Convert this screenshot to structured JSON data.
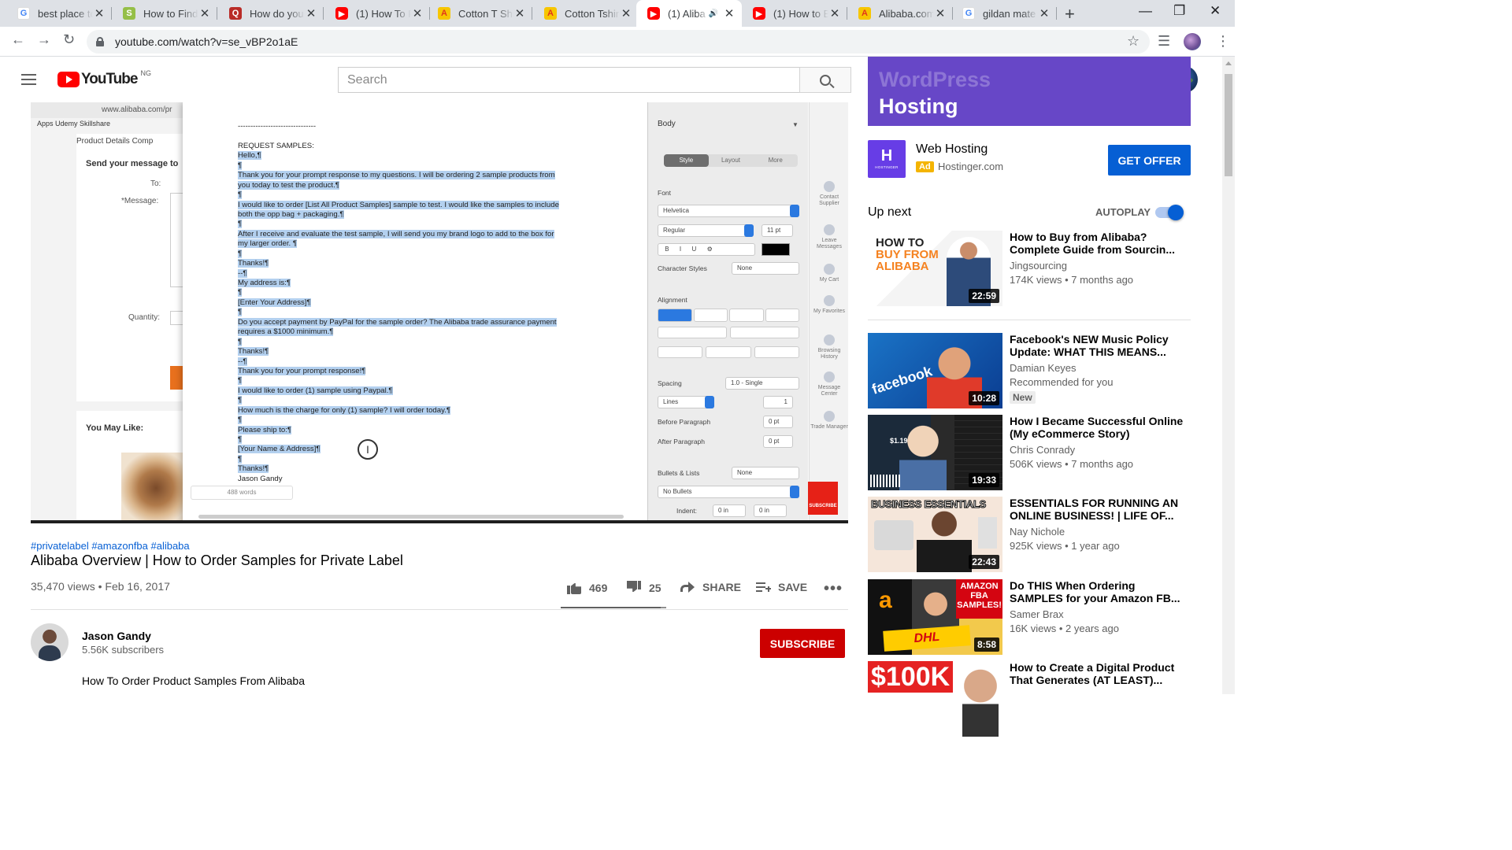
{
  "browser": {
    "tabs": [
      {
        "title": "best place to",
        "favicon": "google-icon"
      },
      {
        "title": "How to Find",
        "favicon": "shopify-icon"
      },
      {
        "title": "How do you",
        "favicon": "quora-icon"
      },
      {
        "title": "(1) How To F",
        "favicon": "youtube-icon"
      },
      {
        "title": "Cotton T Shi",
        "favicon": "alibaba-icon"
      },
      {
        "title": "Cotton Tshir",
        "favicon": "alibaba-icon"
      },
      {
        "title": "(1) Aliba",
        "favicon": "youtube-icon",
        "active": true
      },
      {
        "title": "(1) How to B",
        "favicon": "youtube-icon"
      },
      {
        "title": "Alibaba.com",
        "favicon": "alibaba-icon"
      },
      {
        "title": "gildan mate",
        "favicon": "google-icon"
      }
    ],
    "url": "youtube.com/watch?v=se_vBP2o1aE",
    "close_glyph": "✕",
    "new_tab_glyph": "+"
  },
  "youtube": {
    "logo_text": "YouTube",
    "country_code": "NG",
    "search_placeholder": "Search",
    "notification_count": "1"
  },
  "video_frame": {
    "browser_url": "www.alibaba.com/pr",
    "bookmarks": "Apps   Udemy   Skillshare",
    "tabs_text": "Product Details    Comp",
    "send_message": "Send your message to",
    "labels": {
      "to": "To:",
      "message": "*Message:",
      "quantity": "Quantity:"
    },
    "you_may_like": "You May Like:",
    "doc_lines": [
      {
        "text": "-------------------------------",
        "hl": false
      },
      {
        "text": "",
        "hl": false
      },
      {
        "text": "REQUEST SAMPLES:",
        "hl": false
      },
      {
        "text": "Hello,¶",
        "hl": true
      },
      {
        "text": "¶",
        "hl": true
      },
      {
        "text": "Thank you for your prompt response to my questions. I will be ordering 2 sample products from",
        "hl": true
      },
      {
        "text": "you today to test the product.¶",
        "hl": true
      },
      {
        "text": "¶",
        "hl": true
      },
      {
        "text": "I would like to order [List All Product Samples] sample to test. I would like the samples to include",
        "hl": true
      },
      {
        "text": "both the opp bag + packaging.¶",
        "hl": true
      },
      {
        "text": "¶",
        "hl": true
      },
      {
        "text": "After I receive and evaluate the test sample, I will send you my brand logo to add to the box for",
        "hl": true
      },
      {
        "text": "my larger order. ¶",
        "hl": true
      },
      {
        "text": "¶",
        "hl": true
      },
      {
        "text": "Thanks!¶",
        "hl": true
      },
      {
        "text": "--¶",
        "hl": true
      },
      {
        "text": "My address is:¶",
        "hl": true
      },
      {
        "text": "¶",
        "hl": true
      },
      {
        "text": "[Enter Your Address]¶",
        "hl": true
      },
      {
        "text": "¶",
        "hl": true
      },
      {
        "text": "Do you accept payment by PayPal for the sample order? The Alibaba trade assurance payment",
        "hl": true
      },
      {
        "text": "requires a $1000 minimum.¶",
        "hl": true
      },
      {
        "text": "¶",
        "hl": true
      },
      {
        "text": "Thanks!¶",
        "hl": true
      },
      {
        "text": "--¶",
        "hl": true
      },
      {
        "text": "Thank you for your prompt response!¶",
        "hl": true
      },
      {
        "text": "¶",
        "hl": true
      },
      {
        "text": " I would like to order (1) sample using Paypal.¶",
        "hl": true
      },
      {
        "text": "¶",
        "hl": true
      },
      {
        "text": "How much is the charge for only (1) sample? I will order today.¶",
        "hl": true
      },
      {
        "text": "¶",
        "hl": true
      },
      {
        "text": "Please ship to:¶",
        "hl": true
      },
      {
        "text": "¶",
        "hl": true
      },
      {
        "text": "[Your Name & Address]¶",
        "hl": true
      },
      {
        "text": "¶",
        "hl": true
      },
      {
        "text": "Thanks!¶",
        "hl": true
      },
      {
        "text": "Jason Gandy",
        "hl": false
      }
    ],
    "word_count": "488 words",
    "inspector": {
      "style_dropdown": "Body",
      "tabs": [
        "Style",
        "Layout",
        "More"
      ],
      "font_label": "Font",
      "font_name": "Helvetica",
      "font_weight": "Regular",
      "font_size": "11 pt",
      "char_styles_label": "Character Styles",
      "char_styles_value": "None",
      "alignment_label": "Alignment",
      "spacing_label": "Spacing",
      "spacing_value": "1.0 - Single",
      "lines_label": "Lines",
      "lines_value": "1",
      "before_para": "Before Paragraph",
      "after_para": "After Paragraph",
      "zero_pt": "0 pt",
      "bullets_label": "Bullets & Lists",
      "bullets_value": "None",
      "no_bullets": "No Bullets",
      "indent_label": "Indent:",
      "zero_in": "0 in"
    },
    "side_strip": [
      "Contact Supplier",
      "Leave Messages",
      "My Cart",
      "My Favorites",
      "Browsing History",
      "Message Center",
      "Trade Manager"
    ],
    "subscribe_watermark": "SUBSCRIBE"
  },
  "video": {
    "hashtags": "#privatelabel #amazonfba #alibaba",
    "title": "Alibaba Overview | How to Order Samples for Private Label",
    "meta": "35,470 views • Feb 16, 2017",
    "likes": "469",
    "dislikes": "25",
    "like_ratio": 0.95,
    "share_label": "SHARE",
    "save_label": "SAVE",
    "more_label": "•••"
  },
  "channel": {
    "name": "Jason Gandy",
    "subscribers": "5.56K subscribers",
    "subscribe_label": "SUBSCRIBE",
    "description": "How To Order Product Samples From Alibaba"
  },
  "ad": {
    "banner_ghost": "WordPress",
    "banner_text": "Hosting",
    "logo_letter": "H",
    "logo_brand": "HOSTINGER",
    "title": "Web Hosting",
    "tag": "Ad",
    "domain": "Hostinger.com",
    "cta": "GET OFFER"
  },
  "up_next": {
    "label": "Up next",
    "autoplay_label": "AUTOPLAY",
    "autoplay_on": true
  },
  "recommendations": [
    {
      "title": "How to Buy from Alibaba? Complete Guide from Sourcin...",
      "channel": "Jingsourcing",
      "meta": "174K views • 7 months ago",
      "duration": "22:59",
      "thumb_text": "HOW TO",
      "thumb_text2": "BUY FROM",
      "thumb_text3": "ALIBABA"
    },
    {
      "title": "Facebook's NEW Music Policy Update: WHAT THIS MEANS...",
      "channel": "Damian Keyes",
      "meta": "Recommended for you",
      "badge": "New",
      "duration": "10:28",
      "thumb_text": "facebook"
    },
    {
      "title": "How I Became Successful Online (My eCommerce Story)",
      "channel": "Chris Conrady",
      "meta": "506K views • 7 months ago",
      "duration": "19:33",
      "thumb_text": "$1.19m"
    },
    {
      "title": "ESSENTIALS FOR RUNNING AN ONLINE BUSINESS! | LIFE OF...",
      "channel": "Nay Nichole",
      "meta": "925K views • 1 year ago",
      "duration": "22:43",
      "thumb_text": "BUSINESS ESSENTIALS"
    },
    {
      "title": "Do THIS When Ordering SAMPLES for your Amazon FB...",
      "channel": "Samer Brax",
      "meta": "16K views • 2 years ago",
      "duration": "8:58",
      "thumb_text": "AMAZON FBA SAMPLES!",
      "thumb_text2": "DHL"
    },
    {
      "title": "How to Create a Digital Product That Generates (AT LEAST)...",
      "channel": "",
      "meta": "",
      "duration": "",
      "thumb_text": "$100K"
    }
  ]
}
